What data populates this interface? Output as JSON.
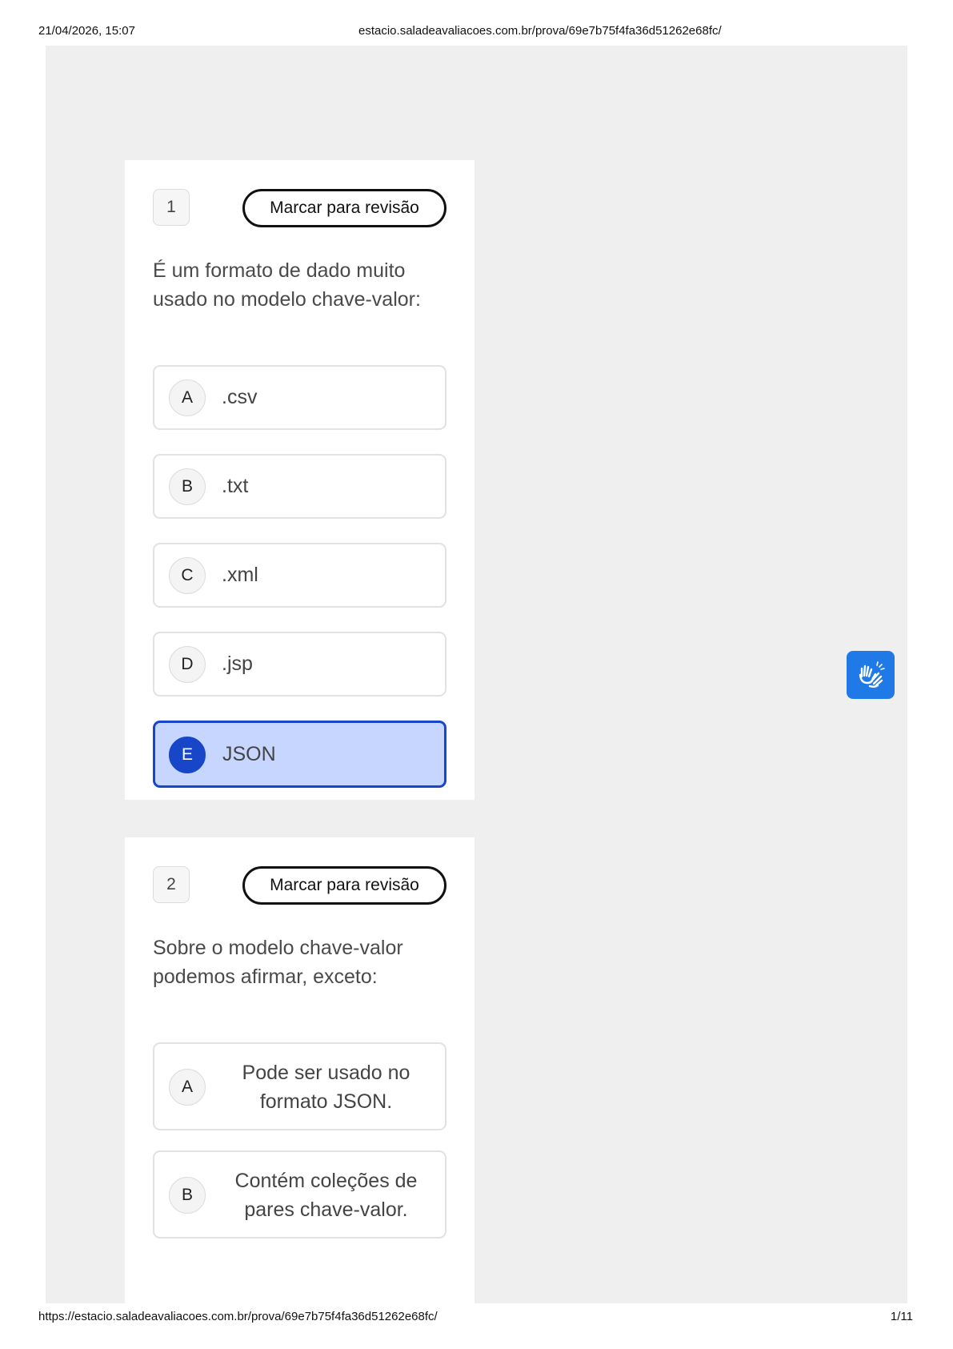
{
  "print_header": {
    "datetime": "21/04/2026, 15:07",
    "url": "estacio.saladeavaliacoes.com.br/prova/69e7b75f4fa36d51262e68fc/"
  },
  "print_footer": {
    "url": "https://estacio.saladeavaliacoes.com.br/prova/69e7b75f4fa36d51262e68fc/",
    "page": "1/11"
  },
  "questions": [
    {
      "number": "1",
      "review_label": "Marcar para revisão",
      "text": "É um formato de dado muito usado no modelo chave-valor:",
      "options": [
        {
          "letter": "A",
          "text": ".csv"
        },
        {
          "letter": "B",
          "text": ".txt"
        },
        {
          "letter": "C",
          "text": ".xml"
        },
        {
          "letter": "D",
          "text": ".jsp"
        },
        {
          "letter": "E",
          "text": "JSON",
          "selected": true
        }
      ]
    },
    {
      "number": "2",
      "review_label": "Marcar para revisão",
      "text": "Sobre o modelo chave-valor podemos afirmar, exceto:",
      "options": [
        {
          "letter": "A",
          "text": "Pode ser usado no formato JSON."
        },
        {
          "letter": "B",
          "text": "Contém coleções de pares chave-valor."
        }
      ]
    }
  ],
  "accessibility_button": {
    "icon": "sign-language-hands-icon",
    "color": "#1f7ae8"
  },
  "colors": {
    "selected_border": "#1746c9",
    "selected_fill": "#c7d6ff",
    "page_bg": "#efefef"
  }
}
